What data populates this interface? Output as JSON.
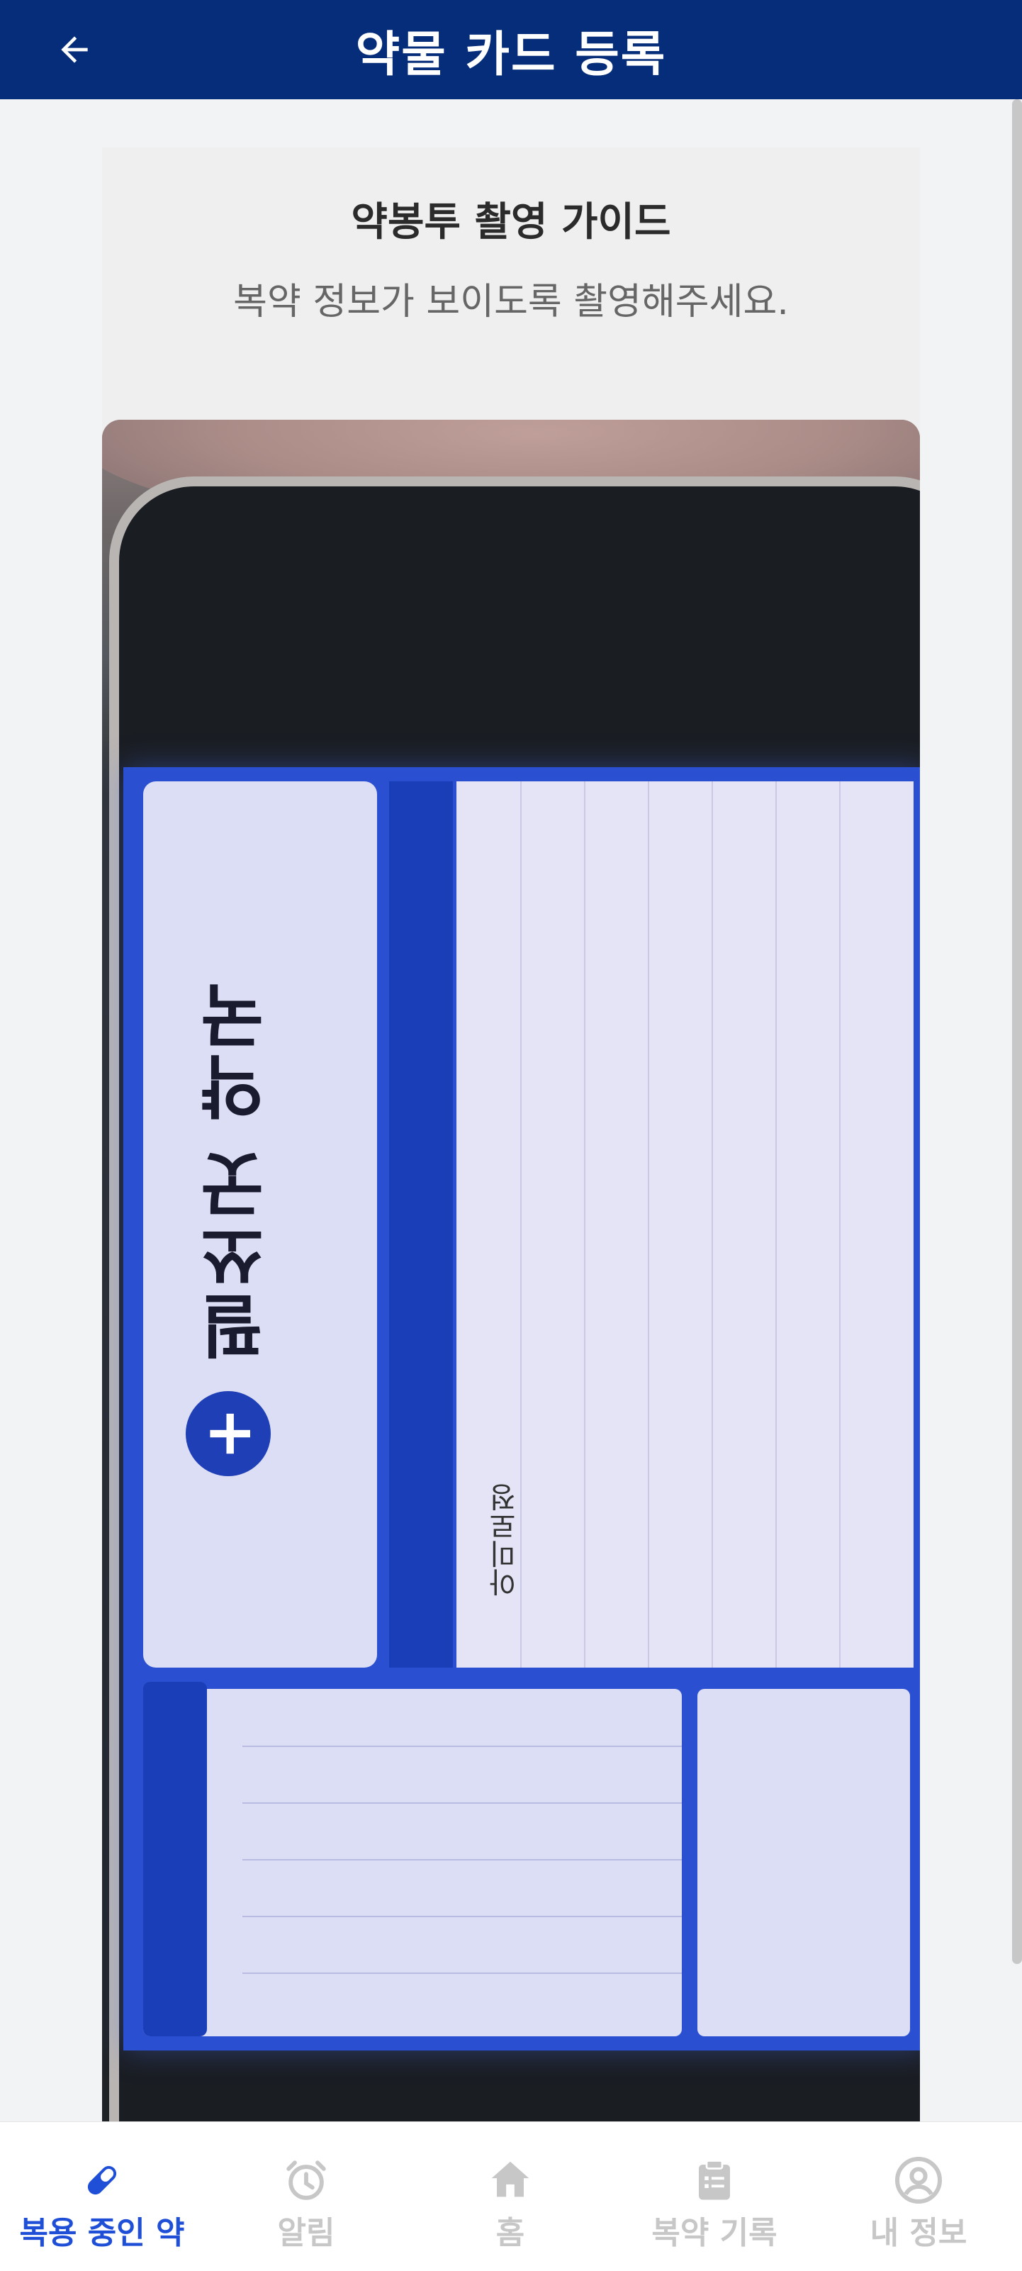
{
  "header": {
    "title": "약물 카드 등록",
    "back_icon": "arrow-left-icon"
  },
  "guide": {
    "title": "약봉투 촬영 가이드",
    "subtitle": "복약 정보가 보이도록 촬영해주세요."
  },
  "photo": {
    "pharmacy_name": "필쏘굿 약국",
    "drug_name": "아미로정"
  },
  "bottom_nav": {
    "items": [
      {
        "label": "복용 중인 약",
        "icon": "pill-icon",
        "active": true
      },
      {
        "label": "알림",
        "icon": "alarm-clock-icon",
        "active": false
      },
      {
        "label": "홈",
        "icon": "home-icon",
        "active": false
      },
      {
        "label": "복약 기록",
        "icon": "clipboard-icon",
        "active": false
      },
      {
        "label": "내 정보",
        "icon": "user-circle-icon",
        "active": false
      }
    ],
    "active_color": "#1f4fd6",
    "inactive_color": "#c7c7c7"
  },
  "colors": {
    "header_bg": "#062d7a",
    "page_bg": "#f2f3f5",
    "card_bg": "#efefef"
  }
}
